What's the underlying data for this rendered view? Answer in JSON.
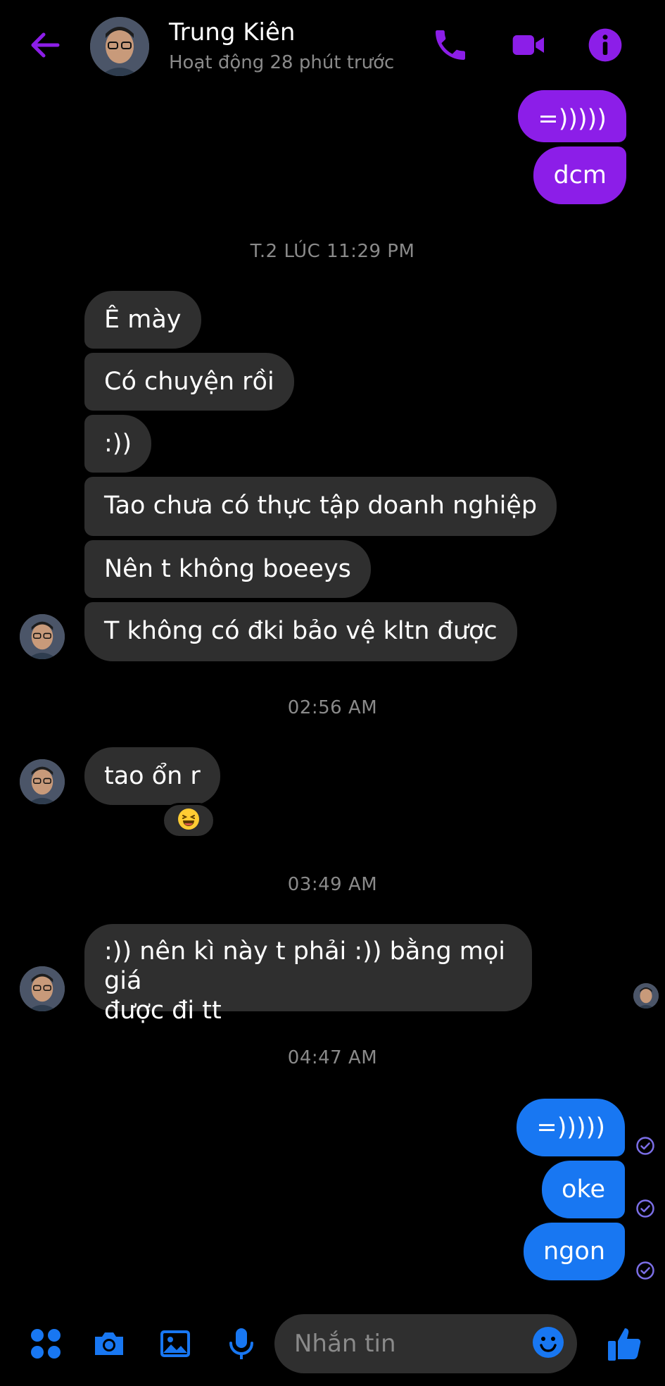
{
  "header": {
    "contact_name": "Trung Kiên",
    "status": "Hoạt động 28 phút trước",
    "icons": [
      "back-arrow-icon",
      "phone-icon",
      "video-camera-icon",
      "info-icon"
    ]
  },
  "colors": {
    "accent_purple": "#8c1ee8",
    "accent_blue": "#1877f2",
    "incoming_bubble": "#2f2f2f",
    "background": "#000000",
    "muted_text": "#8a8a8a"
  },
  "messages": {
    "top_outgoing": [
      "=)))))",
      "dcm"
    ],
    "timestamp_1": "T.2 LÚC 11:29 PM",
    "group_1": [
      "Ê mày",
      "Có chuyện rồi",
      ":))",
      "Tao chưa có thực tập doanh nghiệp",
      "Nên t không boeeys",
      "T không có đki bảo vệ kltn được"
    ],
    "timestamp_2": "02:56 AM",
    "group_2": [
      "tao ổn r"
    ],
    "reaction": "laughing-face-emoji",
    "timestamp_3": "03:49 AM",
    "group_3": [
      ":)) nên kì này t phải :)) bằng mọi giá",
      "được đi tt"
    ],
    "timestamp_4": "04:47 AM",
    "bottom_outgoing": [
      "=)))))",
      "oke",
      "ngon"
    ]
  },
  "composer": {
    "placeholder": "Nhắn tin",
    "icons": [
      "apps-grid-icon",
      "camera-icon",
      "image-icon",
      "microphone-icon",
      "emoji-icon",
      "thumbs-up-icon"
    ]
  }
}
